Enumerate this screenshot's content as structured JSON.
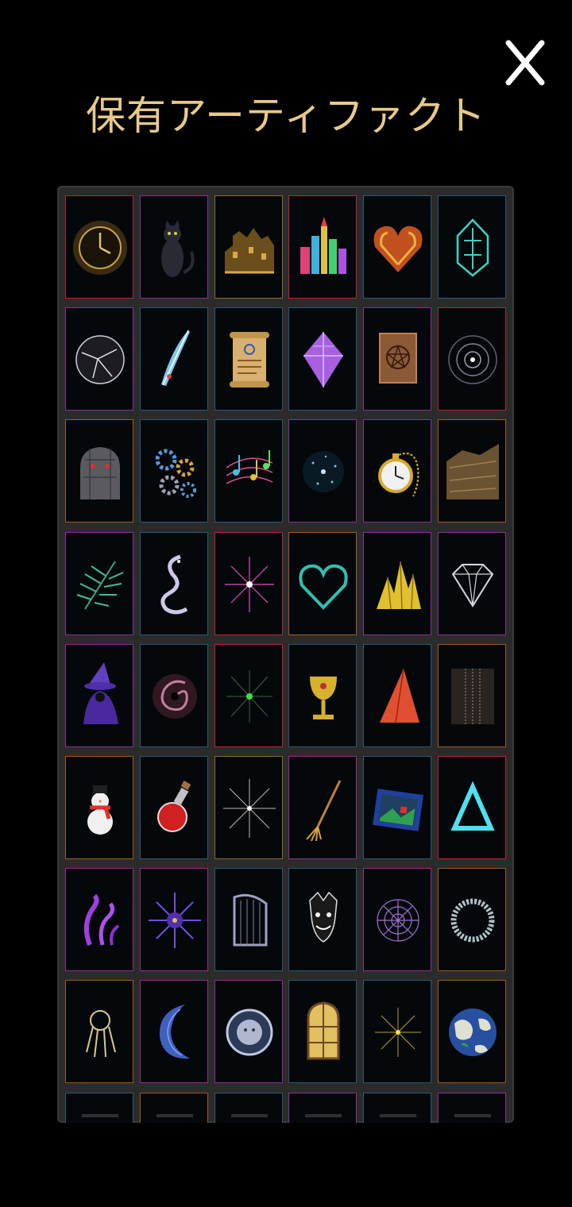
{
  "header": {
    "title": "保有アーティファクト"
  },
  "colors": {
    "title": "#e8c98a",
    "panel": "#2b2b2b",
    "cell_bg": "#05080b",
    "frame": {
      "red": "#b8243a",
      "purple": "#8a2f8f",
      "gold": "#8a6a2a",
      "teal": "#2a5a6e",
      "orange": "#9a5a1e"
    }
  },
  "artifacts": [
    {
      "icon": "clock-sphere-icon",
      "frame": "red"
    },
    {
      "icon": "black-cat-icon",
      "frame": "purple"
    },
    {
      "icon": "gold-town-icon",
      "frame": "gold"
    },
    {
      "icon": "rainbow-castle-icon",
      "frame": "red"
    },
    {
      "icon": "fire-heart-icon",
      "frame": "teal"
    },
    {
      "icon": "rune-crystal-icon",
      "frame": "teal"
    },
    {
      "icon": "cracked-orb-icon",
      "frame": "purple"
    },
    {
      "icon": "blue-feather-icon",
      "frame": "teal"
    },
    {
      "icon": "scroll-icon",
      "frame": "teal"
    },
    {
      "icon": "purple-gem-icon",
      "frame": "teal"
    },
    {
      "icon": "pentagram-tome-icon",
      "frame": "purple"
    },
    {
      "icon": "void-web-icon",
      "frame": "red"
    },
    {
      "icon": "stone-golem-icon",
      "frame": "orange"
    },
    {
      "icon": "gears-icon",
      "frame": "teal"
    },
    {
      "icon": "music-notes-icon",
      "frame": "teal"
    },
    {
      "icon": "star-dust-icon",
      "frame": "purple"
    },
    {
      "icon": "pocket-watch-icon",
      "frame": "purple"
    },
    {
      "icon": "rock-cliff-icon",
      "frame": "orange"
    },
    {
      "icon": "fern-icon",
      "frame": "purple"
    },
    {
      "icon": "ghost-serpent-icon",
      "frame": "teal"
    },
    {
      "icon": "pink-burst-icon",
      "frame": "red"
    },
    {
      "icon": "teal-heart-icon",
      "frame": "orange"
    },
    {
      "icon": "gold-crystals-icon",
      "frame": "purple"
    },
    {
      "icon": "diamond-icon",
      "frame": "purple"
    },
    {
      "icon": "dark-wizard-icon",
      "frame": "purple"
    },
    {
      "icon": "vortex-icon",
      "frame": "teal"
    },
    {
      "icon": "green-spark-icon",
      "frame": "red"
    },
    {
      "icon": "golden-chalice-icon",
      "frame": "teal"
    },
    {
      "icon": "red-blade-icon",
      "frame": "teal"
    },
    {
      "icon": "shimmer-pillar-icon",
      "frame": "orange"
    },
    {
      "icon": "snowman-icon",
      "frame": "orange"
    },
    {
      "icon": "red-potion-icon",
      "frame": "teal"
    },
    {
      "icon": "radiant-star-icon",
      "frame": "gold"
    },
    {
      "icon": "broom-icon",
      "frame": "purple"
    },
    {
      "icon": "landscape-painting-icon",
      "frame": "teal"
    },
    {
      "icon": "triangle-icon",
      "frame": "red"
    },
    {
      "icon": "tentacles-icon",
      "frame": "purple"
    },
    {
      "icon": "urchin-icon",
      "frame": "purple"
    },
    {
      "icon": "harp-icon",
      "frame": "teal"
    },
    {
      "icon": "jester-face-icon",
      "frame": "teal"
    },
    {
      "icon": "spider-web-icon",
      "frame": "purple"
    },
    {
      "icon": "ouroboros-ring-icon",
      "frame": "orange"
    },
    {
      "icon": "key-ring-icon",
      "frame": "orange"
    },
    {
      "icon": "crescent-moon-icon",
      "frame": "purple"
    },
    {
      "icon": "sun-medallion-icon",
      "frame": "purple"
    },
    {
      "icon": "stained-window-icon",
      "frame": "teal"
    },
    {
      "icon": "golden-spark-icon",
      "frame": "teal"
    },
    {
      "icon": "world-globe-icon",
      "frame": "orange"
    },
    {
      "icon": "partial-artifact-icon",
      "frame": "teal"
    },
    {
      "icon": "partial-artifact-icon",
      "frame": "orange"
    },
    {
      "icon": "partial-artifact-icon",
      "frame": "teal"
    },
    {
      "icon": "partial-artifact-icon",
      "frame": "purple"
    },
    {
      "icon": "partial-artifact-icon",
      "frame": "teal"
    },
    {
      "icon": "partial-artifact-icon",
      "frame": "purple"
    }
  ]
}
